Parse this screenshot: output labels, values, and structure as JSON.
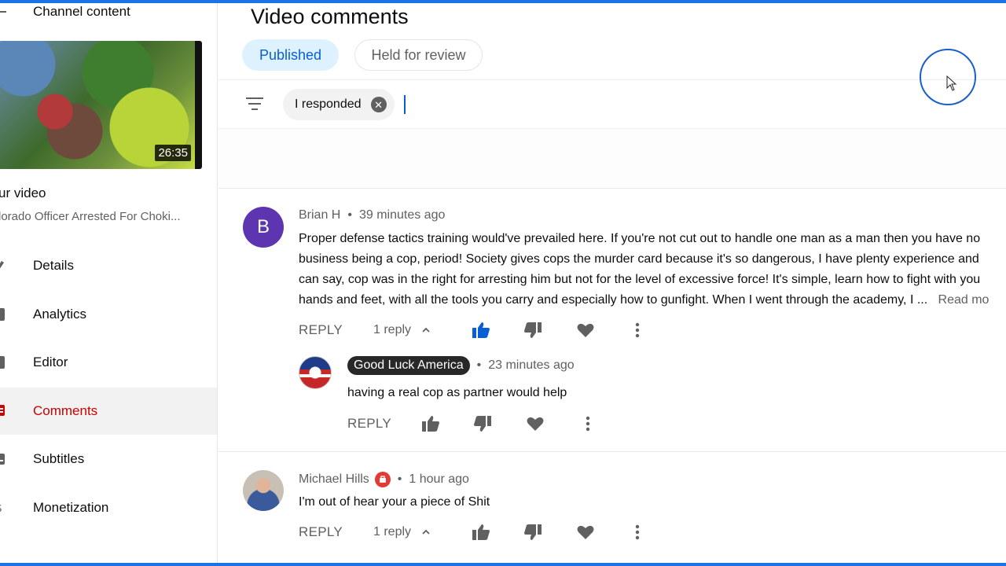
{
  "sidebar": {
    "channel_content": "Channel content",
    "video_duration": "26:35",
    "your_video": "ur video",
    "video_title": "lorado Officer Arrested For Choki...",
    "nav": [
      {
        "label": "Details",
        "icon": "pencil-icon"
      },
      {
        "label": "Analytics",
        "icon": "analytics-icon"
      },
      {
        "label": "Editor",
        "icon": "editor-icon"
      },
      {
        "label": "Comments",
        "icon": "comments-icon",
        "active": true
      },
      {
        "label": "Subtitles",
        "icon": "subtitles-icon"
      },
      {
        "label": "Monetization",
        "icon": "monetization-icon"
      }
    ]
  },
  "main": {
    "title": "Video comments",
    "tabs": [
      {
        "label": "Published",
        "selected": true
      },
      {
        "label": "Held for review",
        "selected": false
      }
    ],
    "filter_chip": "I responded"
  },
  "comments": [
    {
      "avatar_letter": "B",
      "author": "Brian H",
      "time": "39 minutes ago",
      "lines": [
        "Proper defense tactics training would've prevailed here. If you're not cut out to handle one man as a man then you have no",
        "business being a cop, period! Society gives cops the murder card because it's so dangerous, I have plenty experience and",
        "can say, cop was in the right for arresting him but not for the level of excessive force! It's simple, learn how to fight with you",
        "hands and feet, with all the tools you carry and especially how to gunfight. When I went through the academy, I ..."
      ],
      "read_more": "Read mo",
      "reply_label": "REPLY",
      "reply_count": "1 reply",
      "liked": true,
      "reply": {
        "author": "Good Luck America",
        "time": "23 minutes ago",
        "text": "having a real cop as partner would help",
        "reply_label": "REPLY"
      }
    },
    {
      "author": "Michael Hills",
      "time": "1 hour ago",
      "text": "I'm  out of hear your a piece of Shit",
      "reply_label": "REPLY",
      "reply_count": "1 reply",
      "liked": false
    }
  ],
  "colors": {
    "accent": "#065fd4",
    "active_nav": "#cc0000",
    "avatar_b": "#5e35b1",
    "screen_border": "#1a73e8"
  }
}
